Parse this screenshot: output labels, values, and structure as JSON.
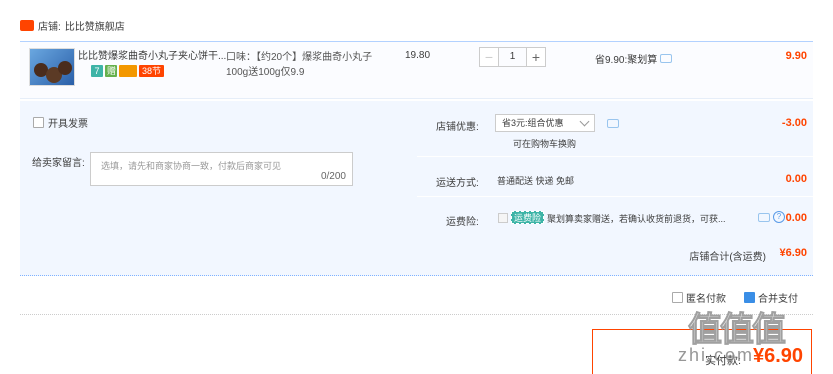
{
  "shop": {
    "label": "店铺:",
    "name": "比比赞旗舰店",
    "icon_text": "tmall"
  },
  "item": {
    "title": "比比赞爆浆曲奇小丸子夹心饼干...",
    "tags": [
      "7",
      "赠",
      "",
      "38节"
    ],
    "spec": "口味：【约20个】爆浆曲奇小丸子100g送100g仅9.9",
    "unit_price": "19.80",
    "qty_minus": "−",
    "qty": "1",
    "qty_plus": "+",
    "saving": "省9.90:聚划算",
    "subtotal": "9.90"
  },
  "invoice": {
    "label": "开具发票"
  },
  "message": {
    "label": "给卖家留言:",
    "placeholder": "选填，请先和商家协商一致，付款后商家可见",
    "count": "0/200"
  },
  "discount": {
    "label": "店铺优惠:",
    "selected": "省3元:组合优惠",
    "hint": "可在购物车换购",
    "value": "-3.00"
  },
  "delivery": {
    "label": "运送方式:",
    "text": "普通配送 快递 免邮",
    "value": "0.00"
  },
  "insurance": {
    "label": "运费险:",
    "badge": "运费险",
    "text": "聚划算卖家赠送，若确认收货前退货，可获...",
    "q": "?",
    "value": "0.00"
  },
  "total": {
    "label": "店铺合计(含运费)",
    "value": "¥6.90"
  },
  "bottom_options": {
    "anonymous": "匿名付款",
    "hold": "合并支付"
  },
  "pay": {
    "label": "实付款:",
    "amount": "¥6.90"
  },
  "watermark": {
    "text": "值值值",
    "url": "zhi.com"
  },
  "colors": {
    "accent": "#ff4400",
    "blue_border": "#b2d1ff",
    "panel_bg": "#f2f7ff"
  }
}
